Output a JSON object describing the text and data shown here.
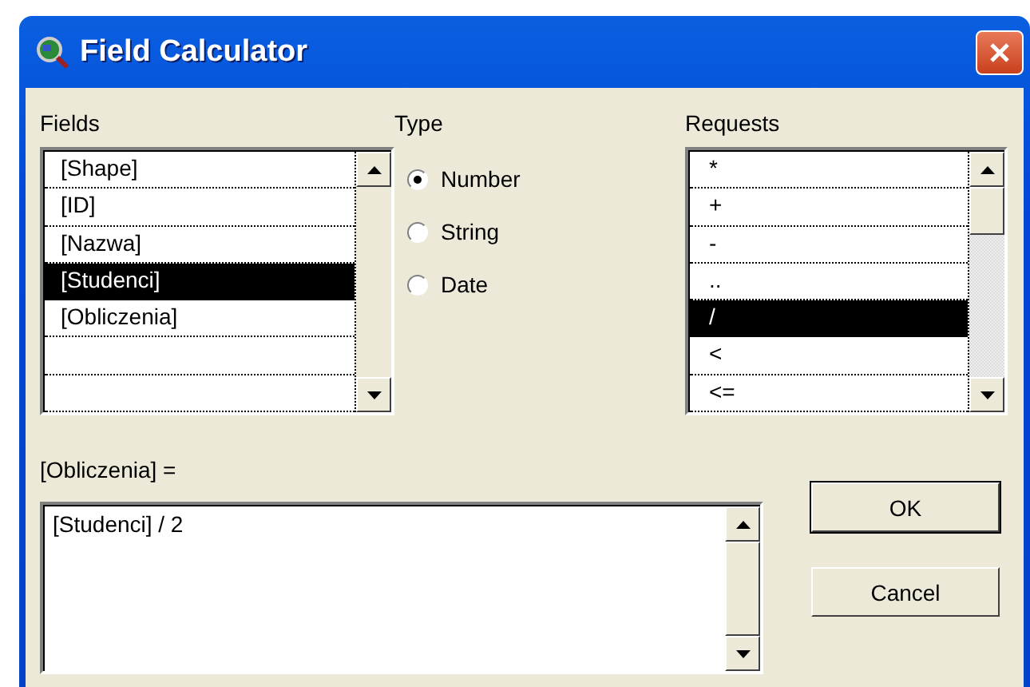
{
  "window": {
    "title": "Field Calculator"
  },
  "fields": {
    "label": "Fields",
    "items": [
      {
        "text": "[Shape]",
        "selected": false
      },
      {
        "text": "[ID]",
        "selected": false
      },
      {
        "text": "[Nazwa]",
        "selected": false
      },
      {
        "text": "[Studenci]",
        "selected": true
      },
      {
        "text": "[Obliczenia]",
        "selected": false
      }
    ]
  },
  "type": {
    "label": "Type",
    "options": [
      {
        "text": "Number",
        "selected": true
      },
      {
        "text": "String",
        "selected": false
      },
      {
        "text": "Date",
        "selected": false
      }
    ]
  },
  "requests": {
    "label": "Requests",
    "items": [
      {
        "text": "*",
        "selected": false
      },
      {
        "text": "+",
        "selected": false
      },
      {
        "text": "-",
        "selected": false
      },
      {
        "text": "..",
        "selected": false
      },
      {
        "text": "/",
        "selected": true
      },
      {
        "text": "<",
        "selected": false
      },
      {
        "text": "<=",
        "selected": false
      }
    ]
  },
  "expression": {
    "label": "[Obliczenia] =",
    "value": "[Studenci] / 2"
  },
  "buttons": [
    "OK",
    "Cancel"
  ]
}
